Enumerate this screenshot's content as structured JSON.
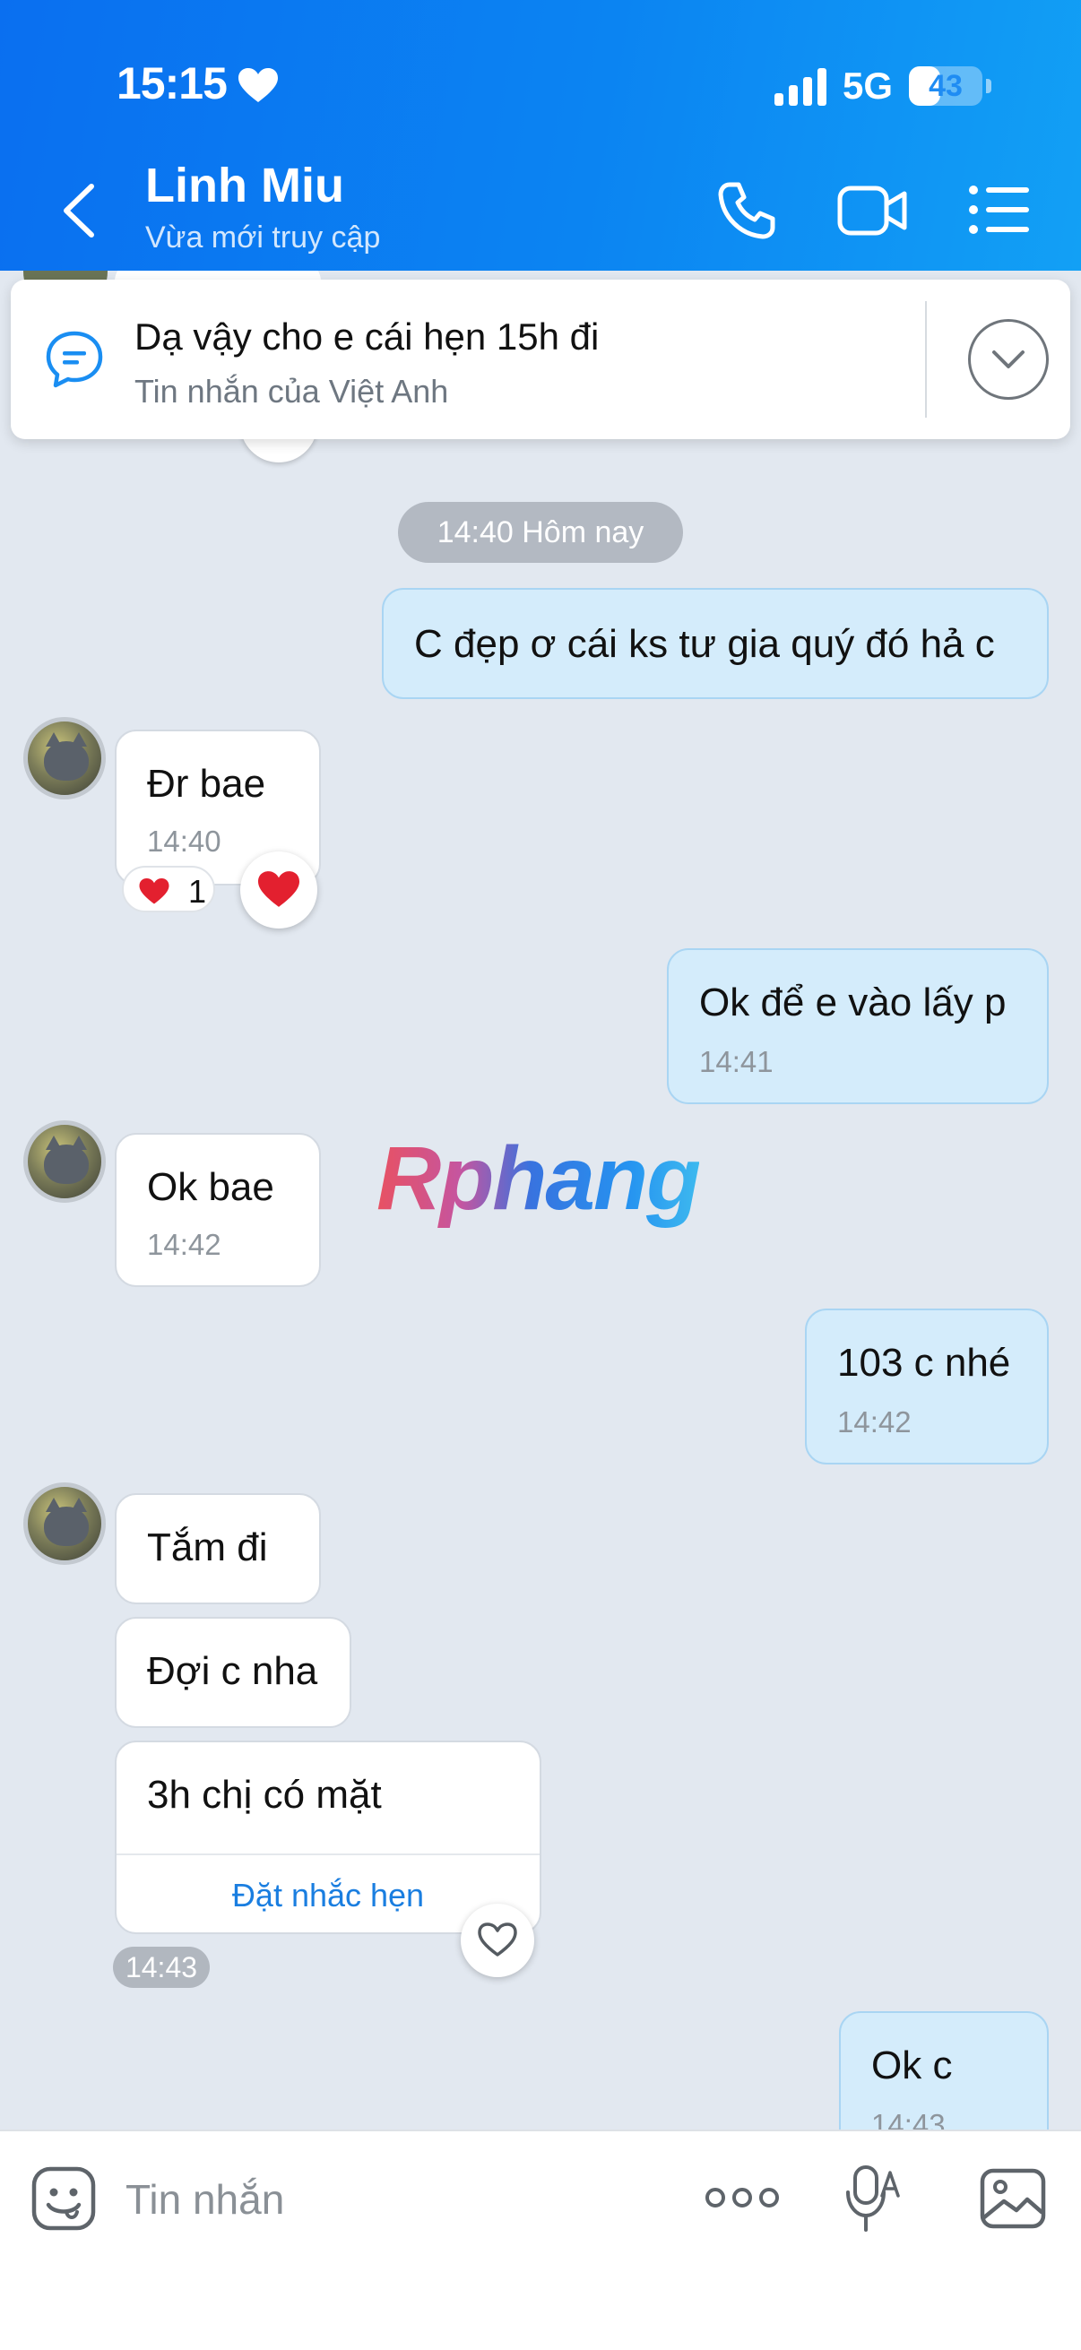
{
  "status_bar": {
    "time": "15:15",
    "network": "5G",
    "battery": "43",
    "battery_level": 0.43
  },
  "header": {
    "contact_name": "Linh Miu",
    "contact_status": "Vừa mới truy cập",
    "icons": [
      "back-icon",
      "call-icon",
      "video-icon",
      "menu-icon"
    ]
  },
  "pinned": {
    "title": "Dạ vậy cho e cái hẹn 15h đi",
    "subtitle": "Tin nhắn của Việt Anh"
  },
  "chat": {
    "date_divider": "14:40 Hôm nay",
    "messages": [
      {
        "side": "out",
        "text": "C đẹp ơ cái ks tư gia quý đó hả c",
        "time": ""
      },
      {
        "side": "in",
        "text": "Đr bae",
        "time": "14:40",
        "reaction_count": "1"
      },
      {
        "side": "out",
        "text": "Ok để e vào lấy p",
        "time": "14:41"
      },
      {
        "side": "in",
        "text": "Ok bae",
        "time": "14:42"
      },
      {
        "side": "out",
        "text": "103 c nhé",
        "time": "14:42"
      },
      {
        "side": "in",
        "text": "Tắm đi",
        "time": ""
      },
      {
        "side": "in",
        "text": "Đợi c nha",
        "time": ""
      },
      {
        "side": "in",
        "text": "3h chị có mặt",
        "time": "14:43",
        "action": "Đặt nhắc hẹn"
      },
      {
        "side": "out",
        "text": "Ok c",
        "time": "14:43"
      }
    ],
    "watermark": "Rphang"
  },
  "composer": {
    "placeholder": "Tin nhắn"
  },
  "colors": {
    "header": "#0b84f2",
    "chat_bg": "#e2e8f0",
    "outgoing_bubble": "#d4ecfb",
    "incoming_bubble": "#ffffff",
    "link": "#1a7ee0"
  }
}
